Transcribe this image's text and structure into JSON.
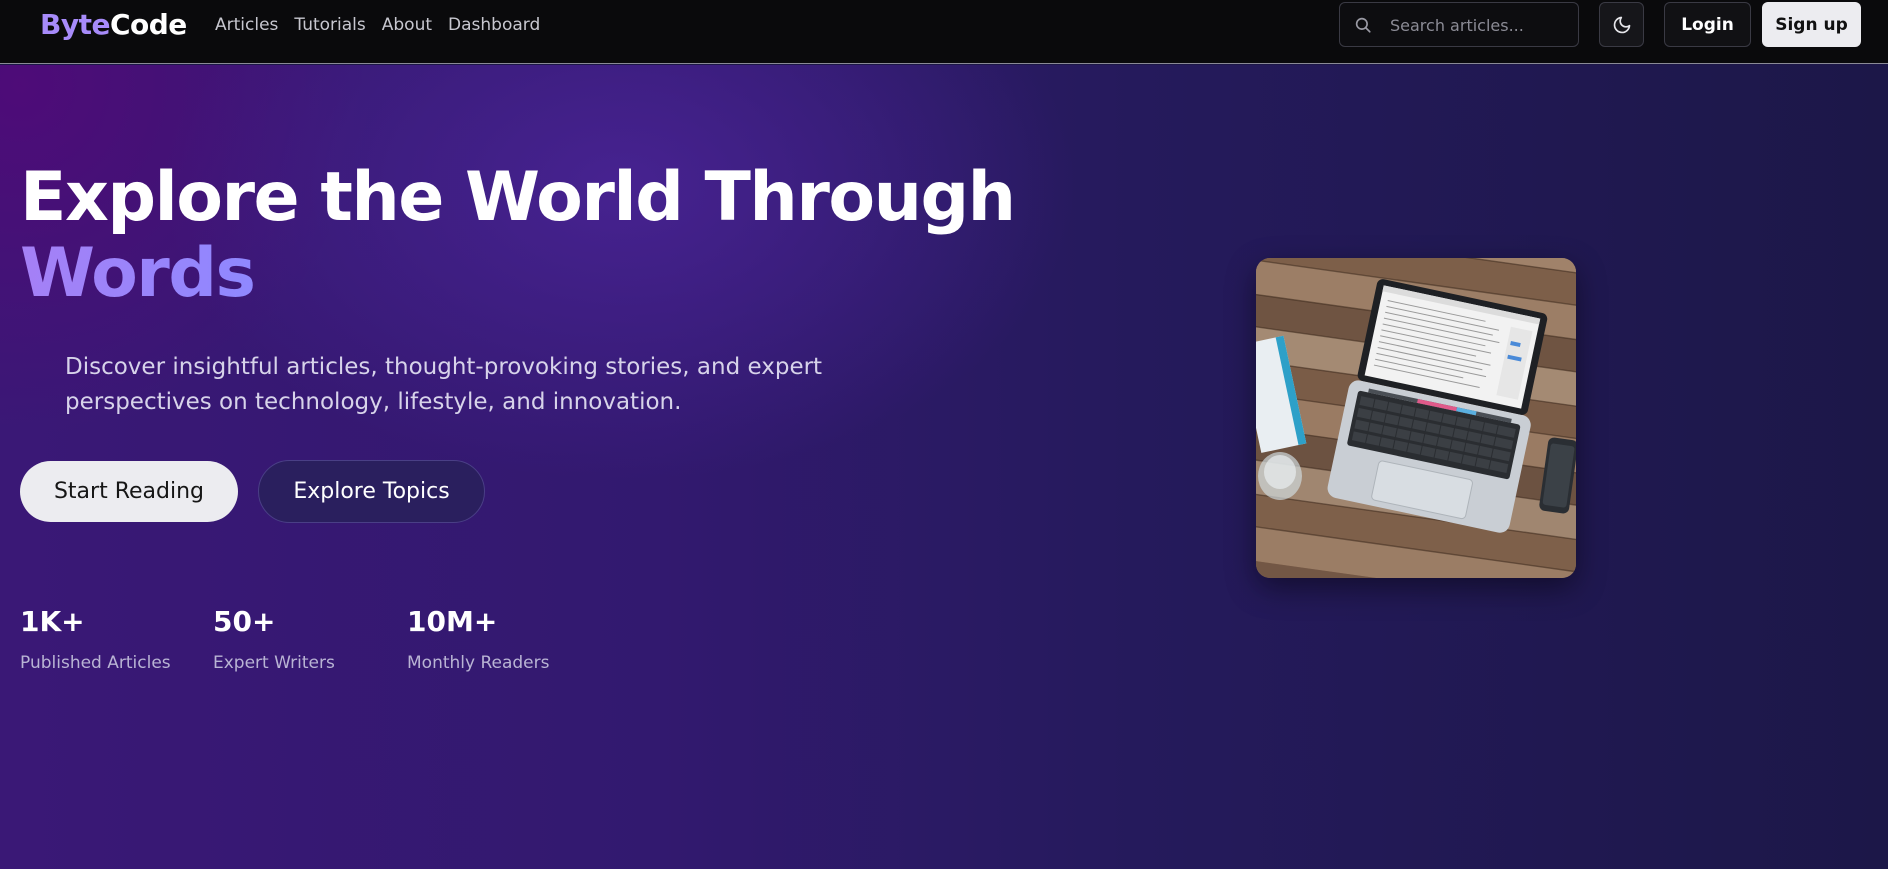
{
  "brand": {
    "part1": "Byte",
    "part2": "Code"
  },
  "nav": {
    "links": [
      {
        "label": "Articles"
      },
      {
        "label": "Tutorials"
      },
      {
        "label": "About"
      },
      {
        "label": "Dashboard"
      }
    ]
  },
  "search": {
    "placeholder": "Search articles...",
    "value": ""
  },
  "actions": {
    "theme_icon": "moon-icon",
    "login_label": "Login",
    "signup_label": "Sign up"
  },
  "hero": {
    "title_line1": "Explore the World Through",
    "title_line2": "Words",
    "subtitle": "Discover insightful articles, thought-provoking stories, and expert perspectives on technology, lifestyle, and innovation.",
    "primary_button": "Start Reading",
    "secondary_button": "Explore Topics",
    "stats": [
      {
        "value": "1K+",
        "label": "Published Articles"
      },
      {
        "value": "50+",
        "label": "Expert Writers"
      },
      {
        "value": "10M+",
        "label": "Monthly Readers"
      }
    ]
  },
  "colors": {
    "brand_accent": "#a78bfa",
    "hero_bg": "#2b1a66",
    "nav_bg": "#0a0a0c"
  }
}
